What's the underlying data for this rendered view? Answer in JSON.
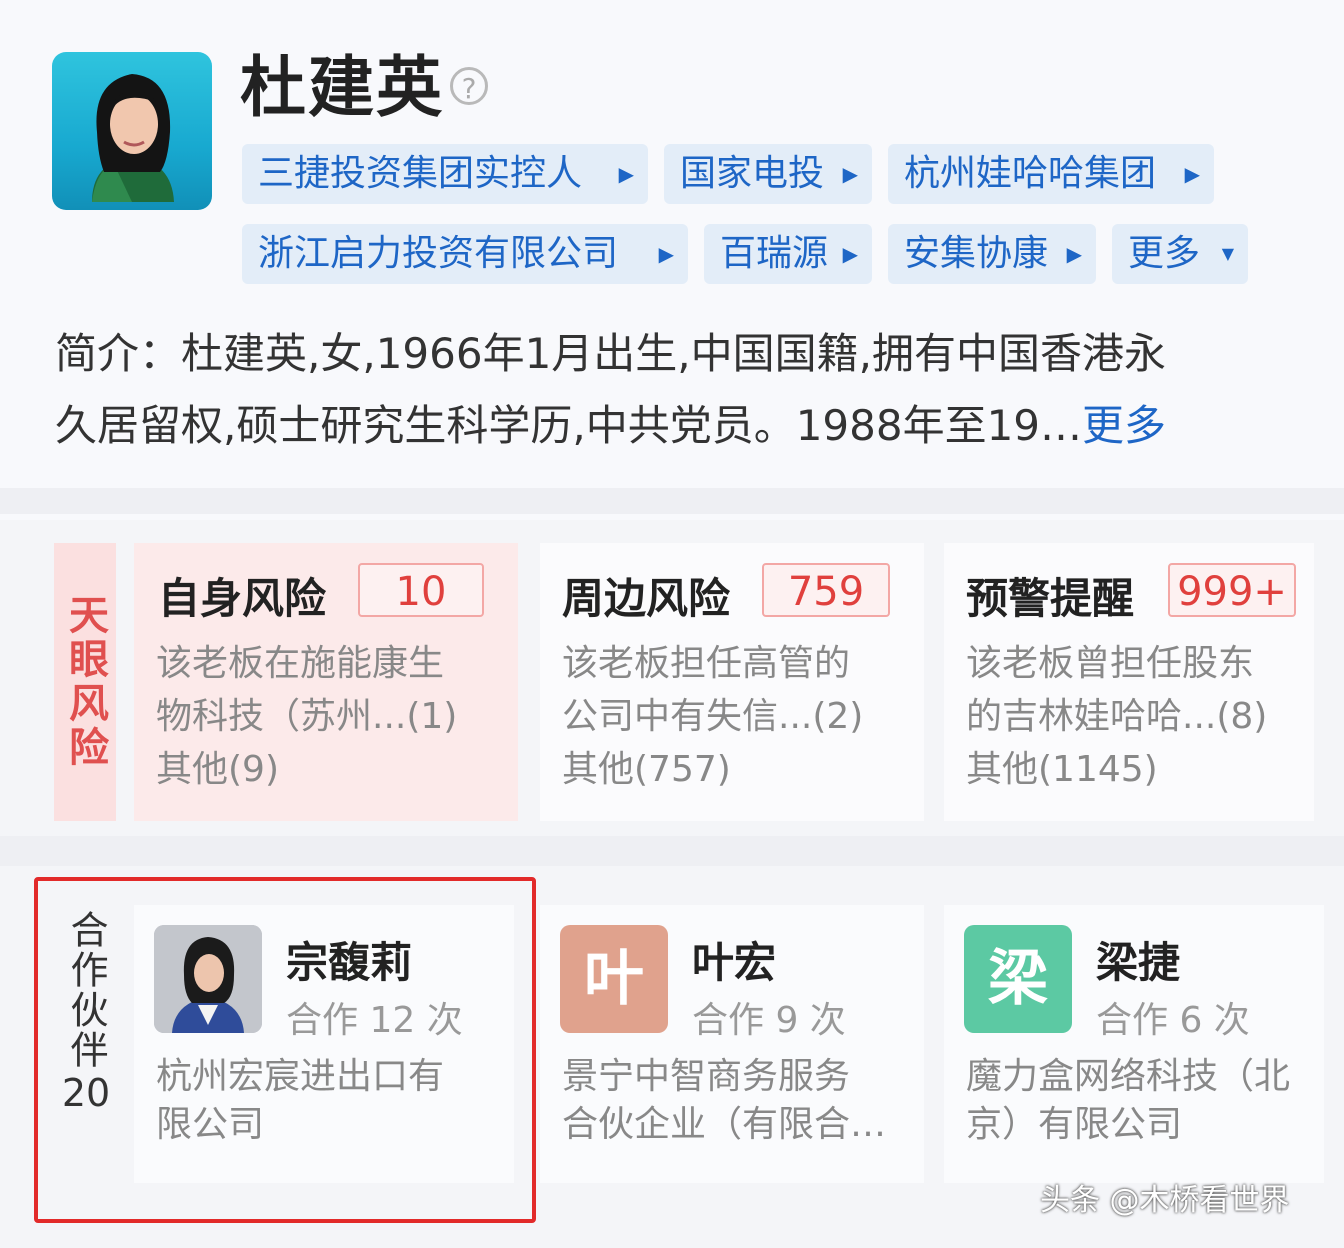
{
  "profile": {
    "name": "杜建英",
    "help_icon": "?",
    "tags": [
      {
        "label": "三捷投资集团实控人"
      },
      {
        "label": "国家电投"
      },
      {
        "label": "杭州娃哈哈集团"
      },
      {
        "label": "浙江启力投资有限公司"
      },
      {
        "label": "百瑞源"
      },
      {
        "label": "安集协康"
      }
    ],
    "more_tags_label": "更多",
    "intro_line1": "简介：杜建英,女,1966年1月出生,中国国籍,拥有中国香港永",
    "intro_line2": "久居留权,硕士研究生科学历,中共党员。1988年至19…",
    "intro_more": "更多"
  },
  "risk": {
    "label": "天眼风险",
    "cards": [
      {
        "title": "自身风险",
        "count": "10",
        "line1": "该老板在施能康生",
        "line2": "物科技（苏州...(1)",
        "line3": "其他(9)"
      },
      {
        "title": "周边风险",
        "count": "759",
        "line1": "该老板担任高管的",
        "line2": "公司中有失信...(2)",
        "line3": "其他(757)"
      },
      {
        "title": "预警提醒",
        "count": "999+",
        "line1": "该老板曾担任股东",
        "line2": "的吉林娃哈哈...(8)",
        "line3": "其他(1145)"
      }
    ]
  },
  "partners": {
    "label": "合作伙伴",
    "count": "20",
    "items": [
      {
        "name": "宗馥莉",
        "avatar_text": "",
        "times": "合作 12 次",
        "company1": "杭州宏宸进出口有",
        "company2": "限公司",
        "avatar_color": "#2f4c9a"
      },
      {
        "name": "叶宏",
        "avatar_text": "叶",
        "times": "合作 9 次",
        "company1": "景宁中智商务服务",
        "company2": "合伙企业（有限合…",
        "avatar_color": "#e0a28d"
      },
      {
        "name": "梁捷",
        "avatar_text": "梁",
        "times": "合作 6 次",
        "company1": "魔力盒网络科技（北",
        "company2": "京）有限公司",
        "avatar_color": "#5cc9a3"
      }
    ]
  },
  "watermark": "头条 @木桥看世界"
}
